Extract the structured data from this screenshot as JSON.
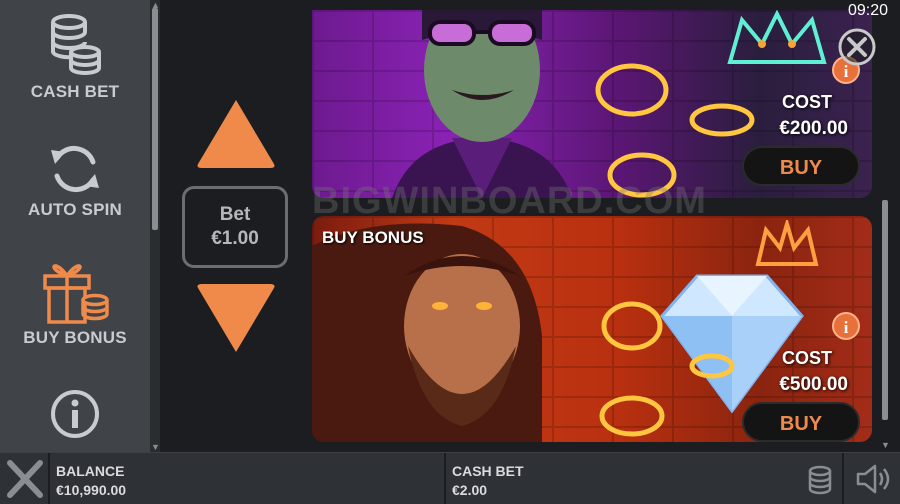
{
  "status": {
    "time": "09:20"
  },
  "left_menu": {
    "items": [
      {
        "label": "CASH BET",
        "icon": "coin-stack-icon",
        "active": false
      },
      {
        "label": "AUTO SPIN",
        "icon": "refresh-icon",
        "active": false
      },
      {
        "label": "BUY BONUS",
        "icon": "gift-icon",
        "active": true
      },
      {
        "label": "",
        "icon": "info-icon",
        "active": false
      }
    ]
  },
  "bet": {
    "label": "Bet",
    "value": "€1.00"
  },
  "watermark": "BIGWINBOARD.COM",
  "cards": [
    {
      "title": "",
      "cost_label": "COST",
      "cost_value": "€200.00",
      "buy_label": "BUY"
    },
    {
      "title": "BUY BONUS",
      "cost_label": "COST",
      "cost_value": "€500.00",
      "buy_label": "BUY"
    }
  ],
  "footer": {
    "balance_label": "BALANCE",
    "balance_value": "€10,990.00",
    "cashbet_label": "CASH BET",
    "cashbet_value": "€2.00"
  },
  "colors": {
    "accent": "#f08a4b",
    "menu_bg": "#404448",
    "inactive_text": "#c8cbcf"
  }
}
